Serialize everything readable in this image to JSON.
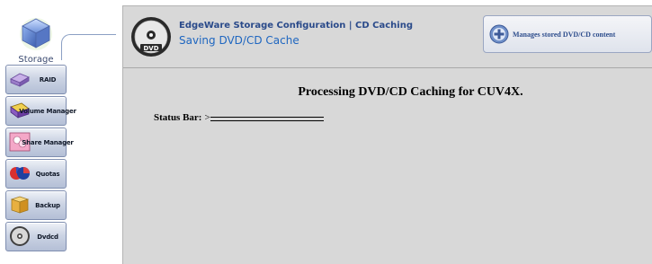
{
  "sidebar": {
    "top_tab": {
      "label": "Storage",
      "icon": "storage-cube-icon"
    },
    "items": [
      {
        "label": "RAID",
        "icon": "raid-disk-icon"
      },
      {
        "label": "Volume Manager",
        "icon": "volume-manager-icon"
      },
      {
        "label": "Share Manager",
        "icon": "share-manager-icon"
      },
      {
        "label": "Quotas",
        "icon": "quotas-pie-icon"
      },
      {
        "label": "Backup",
        "icon": "backup-box-icon"
      },
      {
        "label": "Dvdcd",
        "icon": "dvd-disc-icon"
      }
    ]
  },
  "header": {
    "logo_icon": "dvd-logo-icon",
    "breadcrumb": "EdgeWare Storage Configuration | CD Caching",
    "title": "Saving DVD/CD Cache",
    "action_button": {
      "label": "Manages stored DVD/CD content",
      "icon": "plus-circle-icon"
    }
  },
  "content": {
    "heading": "Processing DVD/CD Caching for CUV4X.",
    "status_label": "Status Bar:",
    "status_arrow": ">"
  },
  "colors": {
    "frame_bg": "#d8d8d8",
    "header_link": "#2a4a8a",
    "header_title": "#1e66c0",
    "nav_gradient_top": "#eef1f7",
    "nav_gradient_bottom": "#b4bfd6"
  }
}
